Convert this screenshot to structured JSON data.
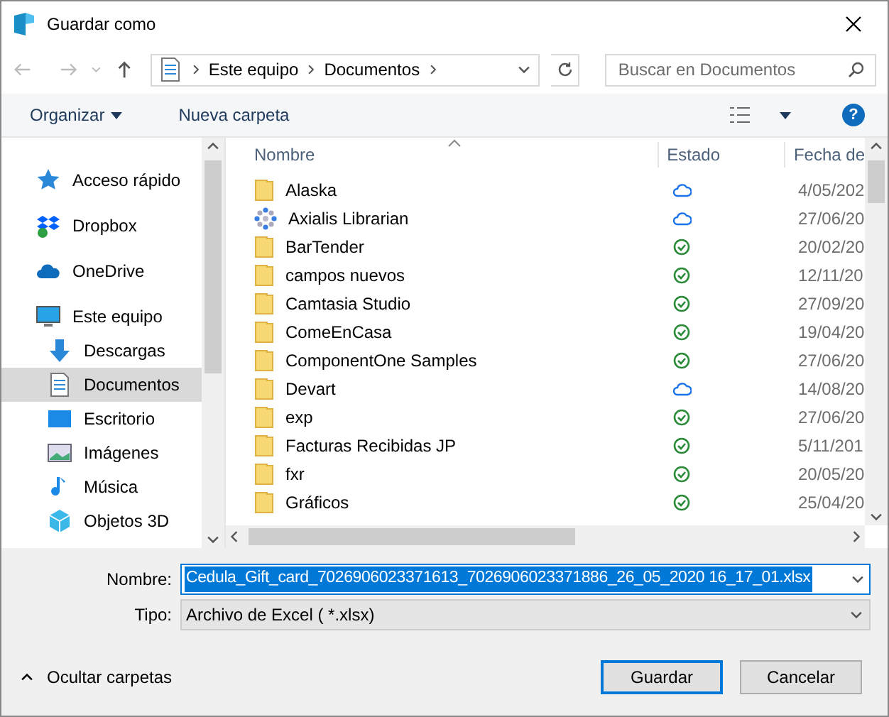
{
  "window": {
    "title": "Guardar como"
  },
  "address": {
    "crumbs": [
      "Este equipo",
      "Documentos"
    ]
  },
  "search": {
    "placeholder": "Buscar en Documentos"
  },
  "toolbar": {
    "organize": "Organizar",
    "new_folder": "Nueva carpeta",
    "help": "?"
  },
  "sidebar": {
    "items": [
      {
        "label": "Acceso rápido",
        "kind": "star",
        "selected": false
      },
      {
        "label": "Dropbox",
        "kind": "dropbox",
        "selected": false
      },
      {
        "label": "OneDrive",
        "kind": "cloud",
        "selected": false
      },
      {
        "label": "Este equipo",
        "kind": "pc",
        "selected": false,
        "children": [
          {
            "label": "Descargas",
            "kind": "download",
            "selected": false
          },
          {
            "label": "Documentos",
            "kind": "doc",
            "selected": true
          },
          {
            "label": "Escritorio",
            "kind": "desktop",
            "selected": false
          },
          {
            "label": "Imágenes",
            "kind": "image",
            "selected": false
          },
          {
            "label": "Música",
            "kind": "music",
            "selected": false
          },
          {
            "label": "Objetos 3D",
            "kind": "cube",
            "selected": false
          }
        ]
      }
    ]
  },
  "table": {
    "columns": [
      "Nombre",
      "Estado",
      "Fecha de"
    ],
    "rows": [
      {
        "name": "Alaska",
        "kind": "folder",
        "synced": false,
        "date": "4/05/202"
      },
      {
        "name": "Axialis Librarian",
        "kind": "app",
        "synced": false,
        "date": "27/06/20"
      },
      {
        "name": "BarTender",
        "kind": "folder",
        "synced": true,
        "date": "20/02/20"
      },
      {
        "name": "campos nuevos",
        "kind": "folder",
        "synced": true,
        "date": "12/11/20"
      },
      {
        "name": "Camtasia Studio",
        "kind": "folder",
        "synced": true,
        "date": "27/09/20"
      },
      {
        "name": "ComeEnCasa",
        "kind": "folder",
        "synced": true,
        "date": "19/04/20"
      },
      {
        "name": "ComponentOne Samples",
        "kind": "folder",
        "synced": true,
        "date": "27/06/20"
      },
      {
        "name": "Devart",
        "kind": "folder",
        "synced": false,
        "date": "14/08/20"
      },
      {
        "name": "exp",
        "kind": "folder",
        "synced": true,
        "date": "27/06/20"
      },
      {
        "name": "Facturas Recibidas JP",
        "kind": "folder",
        "synced": true,
        "date": "5/11/201"
      },
      {
        "name": "fxr",
        "kind": "folder",
        "synced": true,
        "date": "20/05/20"
      },
      {
        "name": "Gráficos",
        "kind": "folder",
        "synced": true,
        "date": "25/04/20"
      }
    ]
  },
  "form": {
    "name_label": "Nombre:",
    "name_value": "Cedula_Gift_card_7026906023371613_7026906023371886_26_05_2020 16_17_01.xlsx",
    "type_label": "Tipo:",
    "type_value": "Archivo de Excel ( *.xlsx)"
  },
  "footer": {
    "toggle": "Ocultar carpetas",
    "save": "Guardar",
    "cancel": "Cancelar"
  }
}
